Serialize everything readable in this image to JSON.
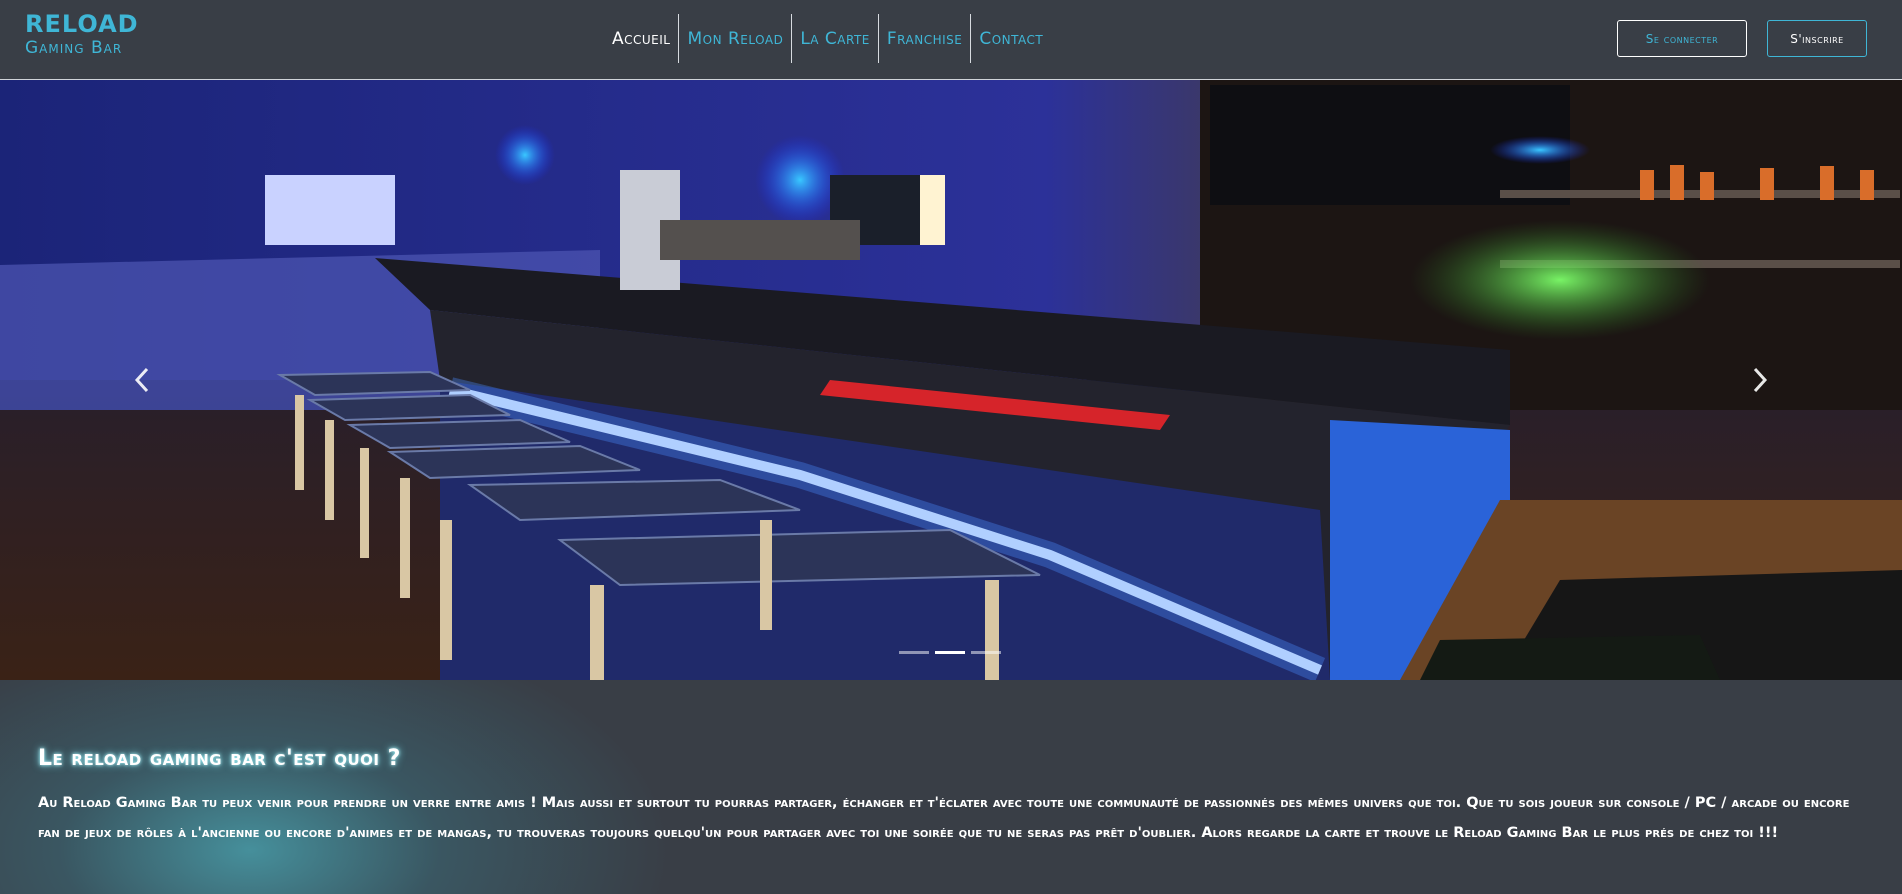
{
  "brand": {
    "line1": "RELOAD",
    "line2": "Gaming Bar"
  },
  "nav": {
    "items": [
      {
        "label": "Accueil",
        "active": true
      },
      {
        "label": "Mon Reload",
        "active": false
      },
      {
        "label": "La Carte",
        "active": false
      },
      {
        "label": "Franchise",
        "active": false
      },
      {
        "label": "Contact",
        "active": false
      }
    ]
  },
  "auth": {
    "login_label": "Se connecter",
    "signup_label": "S'inscrire"
  },
  "carousel": {
    "prev_icon": "chevron-left-icon",
    "next_icon": "chevron-right-icon",
    "slide_count": 3,
    "active_slide": 2
  },
  "about": {
    "title": "Le reload gaming bar c'est quoi ?",
    "text": "Au Reload Gaming Bar tu peux venir pour prendre un verre entre amis ! Mais aussi et surtout tu pourras partager, échanger et t'éclater avec toute une communauté de passionnés des mêmes univers que toi. Que tu sois joueur sur console / PC / arcade ou encore fan de jeux de rôles à l'ancienne ou encore d'animes et de mangas, tu trouveras toujours quelqu'un pour partager avec toi une soirée que tu ne seras pas prêt d'oublier. Alors regarde la carte et trouve le Reload Gaming Bar le plus prés de chez toi !!!"
  },
  "colors": {
    "accent": "#3fb6d6",
    "background": "#393e46",
    "glow": "#7ee7f2"
  }
}
